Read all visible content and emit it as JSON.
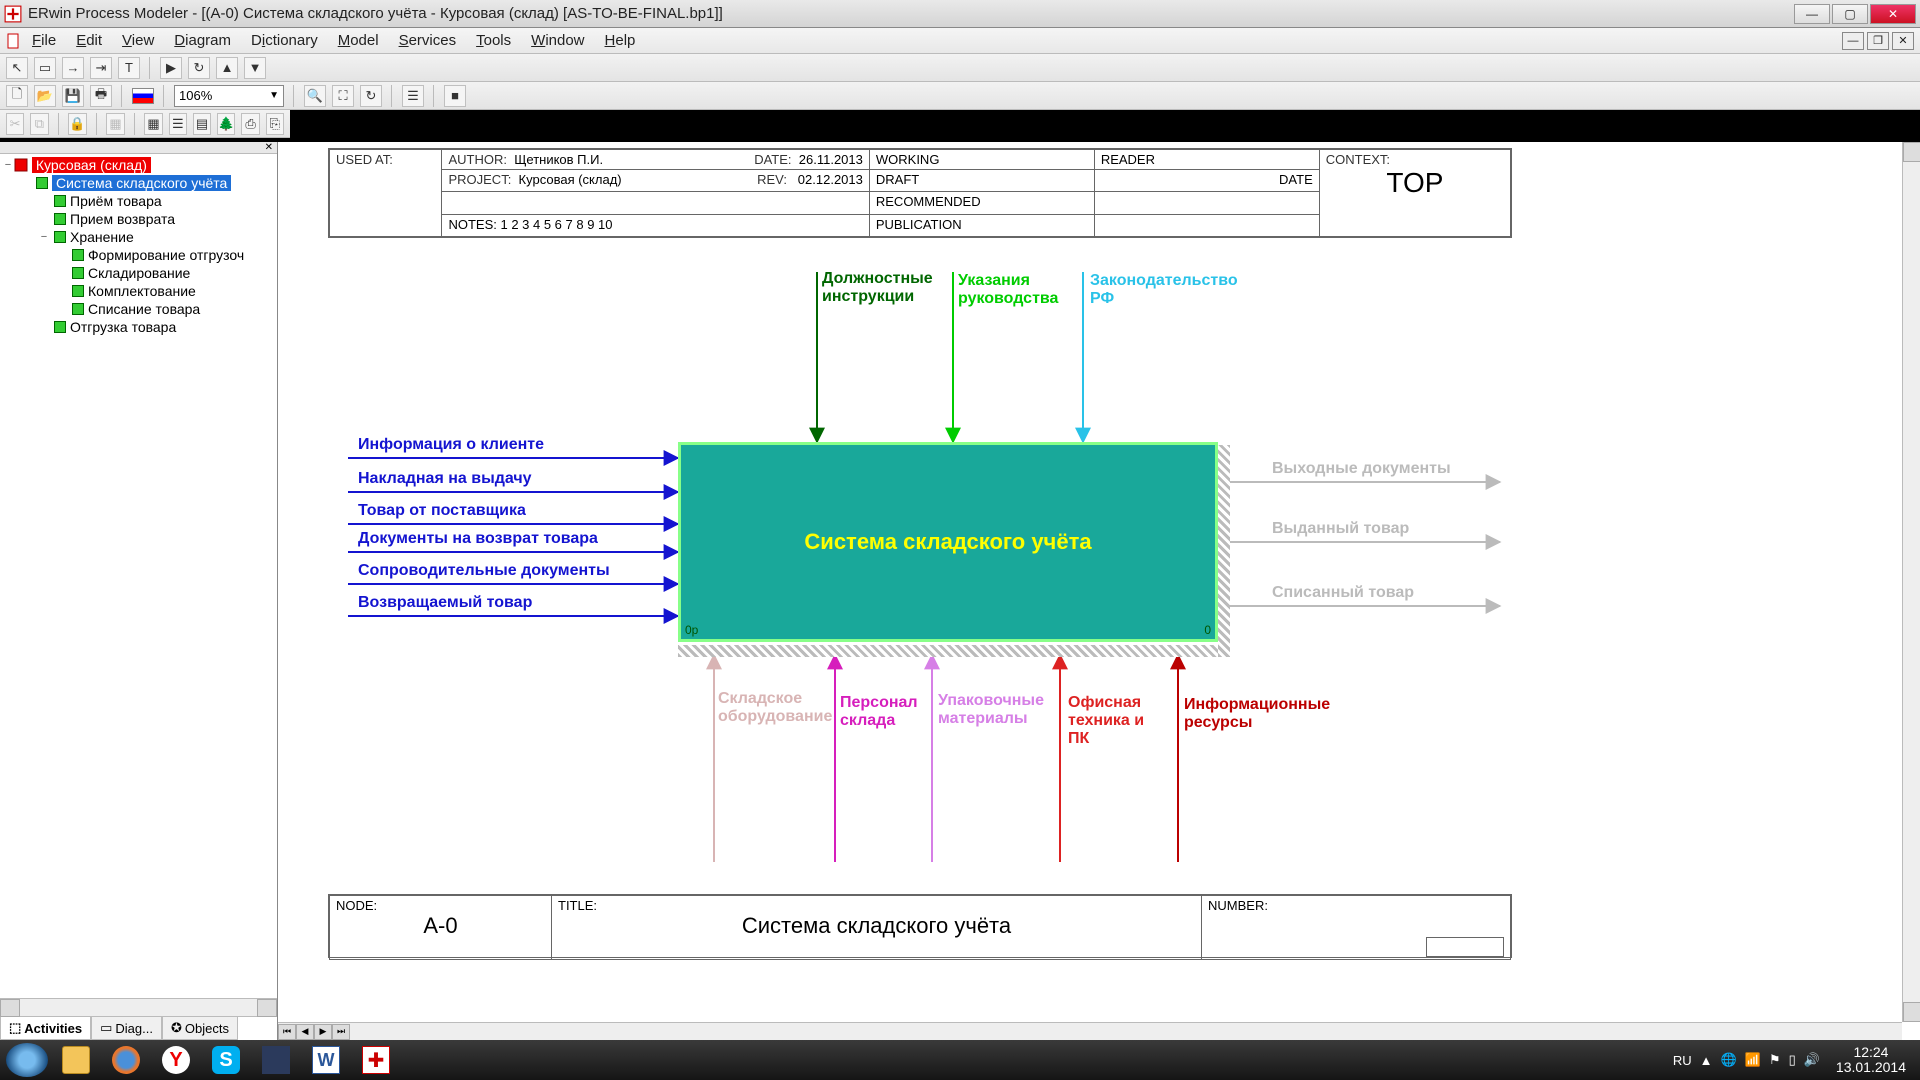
{
  "title": "ERwin Process Modeler - [(A-0) Система складского учёта - Курсовая (склад)  [AS-TO-BE-FINAL.bp1]]",
  "menu": {
    "file": "File",
    "edit": "Edit",
    "view": "View",
    "diagram": "Diagram",
    "dictionary": "Dictionary",
    "model": "Model",
    "services": "Services",
    "tools": "Tools",
    "window": "Window",
    "help": "Help"
  },
  "zoom": "106%",
  "tree": {
    "root": "Курсовая (склад)",
    "items": [
      {
        "label": "Система складского учёта",
        "sel": true,
        "indent": 1
      },
      {
        "label": "Приём товара",
        "indent": 2
      },
      {
        "label": "Прием возврата",
        "indent": 2
      },
      {
        "label": "Хранение",
        "indent": 2,
        "exp": true
      },
      {
        "label": "Формирование отгрузоч",
        "indent": 3
      },
      {
        "label": "Складирование",
        "indent": 3
      },
      {
        "label": "Комплектование",
        "indent": 3
      },
      {
        "label": "Списание товара",
        "indent": 3
      },
      {
        "label": "Отгрузка товара",
        "indent": 2
      }
    ]
  },
  "sidetabs": {
    "activities": "Activities",
    "diag": "Diag...",
    "objects": "Objects"
  },
  "header": {
    "used_at": "USED AT:",
    "author_l": "AUTHOR:",
    "author": "Щетников П.И.",
    "project_l": "PROJECT:",
    "project": "Курсовая (склад)",
    "notes": "NOTES:  1  2  3  4  5  6  7  8  9  10",
    "date_l": "DATE:",
    "date": "26.11.2013",
    "rev_l": "REV:",
    "rev": "02.12.2013",
    "working": "WORKING",
    "draft": "DRAFT",
    "recommended": "RECOMMENDED",
    "publication": "PUBLICATION",
    "reader": "READER",
    "date2": "DATE",
    "context_l": "CONTEXT:",
    "context": "TOP"
  },
  "footer": {
    "node_l": "NODE:",
    "node": "A-0",
    "title_l": "TITLE:",
    "title": "Система складского учёта",
    "number_l": "NUMBER:"
  },
  "activity": {
    "name": "Система складского учёта",
    "bl": "0p",
    "br": "0"
  },
  "inputs": [
    "Информация о клиенте",
    "Накладная на выдачу",
    "Товар от поставщика",
    "Документы на возврат товара",
    "Сопроводительные документы",
    "Возвращаемый товар"
  ],
  "controls": [
    "Должностные инструкции",
    "Указания руководства",
    "Законодательство РФ"
  ],
  "outputs": [
    "Выходные документы",
    "Выданный товар",
    "Списанный товар"
  ],
  "mechanisms": [
    "Складское оборудование",
    "Персонал склада",
    "Упаковочные материалы",
    "Офисная техника и ПК",
    "Информационные ресурсы"
  ],
  "tray": {
    "lang": "RU",
    "time": "12:24",
    "date": "13.01.2014"
  }
}
